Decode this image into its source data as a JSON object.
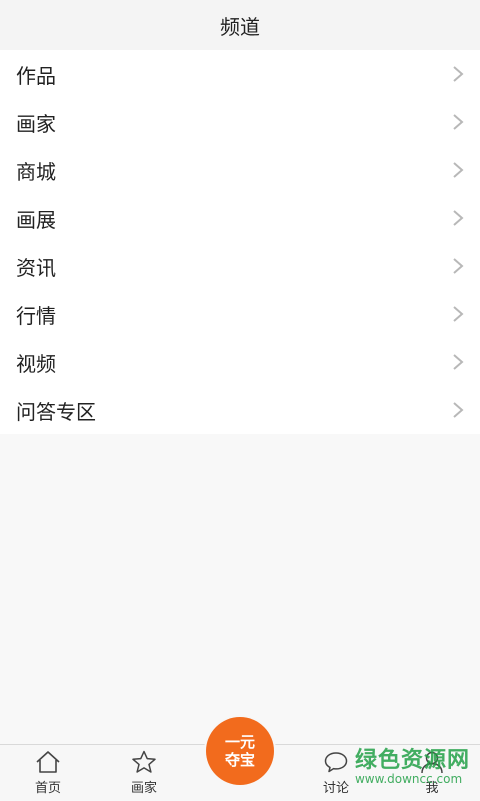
{
  "header": {
    "title": "频道"
  },
  "channels": [
    {
      "label": "作品"
    },
    {
      "label": "画家"
    },
    {
      "label": "商城"
    },
    {
      "label": "画展"
    },
    {
      "label": "资讯"
    },
    {
      "label": "行情"
    },
    {
      "label": "视频"
    },
    {
      "label": "问答专区"
    }
  ],
  "tabbar": {
    "home": {
      "label": "首页",
      "icon": "home-icon"
    },
    "artist": {
      "label": "画家",
      "icon": "star-icon"
    },
    "center": {
      "line1": "一元",
      "line2": "夺宝"
    },
    "discuss": {
      "label": "讨论",
      "icon": "chat-bubble-icon"
    },
    "me": {
      "label": "我",
      "icon": "user-icon"
    }
  },
  "watermark": {
    "title": "绿色资源网",
    "url": "www.downcc.com"
  },
  "colors": {
    "accent": "#f26b1d",
    "background": "#f8f8f8"
  }
}
